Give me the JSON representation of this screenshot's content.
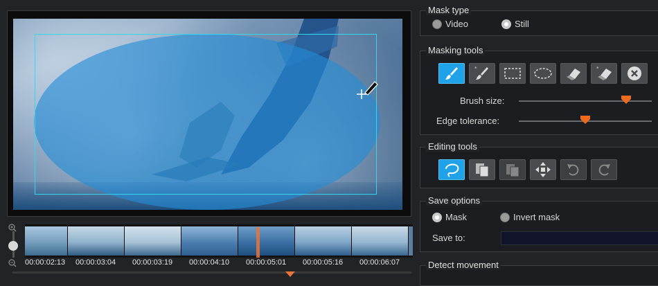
{
  "mask_type": {
    "title": "Mask type",
    "options": [
      {
        "label": "Video",
        "checked": false
      },
      {
        "label": "Still",
        "checked": true
      }
    ]
  },
  "masking_tools": {
    "title": "Masking tools",
    "tools": [
      "smart-brush-icon",
      "brush-icon",
      "rectangle-select-icon",
      "ellipse-select-icon",
      "smart-eraser-icon",
      "eraser-icon",
      "clear-icon"
    ],
    "brush_size_label": "Brush size:",
    "brush_size_value": 0.9,
    "edge_tolerance_label": "Edge tolerance:",
    "edge_tolerance_value": 0.5
  },
  "editing_tools": {
    "title": "Editing tools",
    "tools": [
      "lasso-icon",
      "copy-icon",
      "paste-icon",
      "move-icon",
      "undo-icon",
      "redo-icon"
    ]
  },
  "save_options": {
    "title": "Save options",
    "options": [
      {
        "label": "Mask",
        "checked": true
      },
      {
        "label": "Invert mask",
        "checked": false
      }
    ],
    "save_to_label": "Save to:",
    "save_to_value": ""
  },
  "detect_movement": {
    "title": "Detect movement"
  },
  "timeline": {
    "timecodes": [
      "00:00:02:13",
      "00:00:03:04",
      "00:00:03:19",
      "00:00:04:10",
      "00:00:05:01",
      "00:00:05:16",
      "00:00:06:07"
    ]
  },
  "colors": {
    "accent": "#1fa2e8",
    "marker": "#e8743a",
    "mask": "#238cd7",
    "selection": "#33d8f0"
  }
}
